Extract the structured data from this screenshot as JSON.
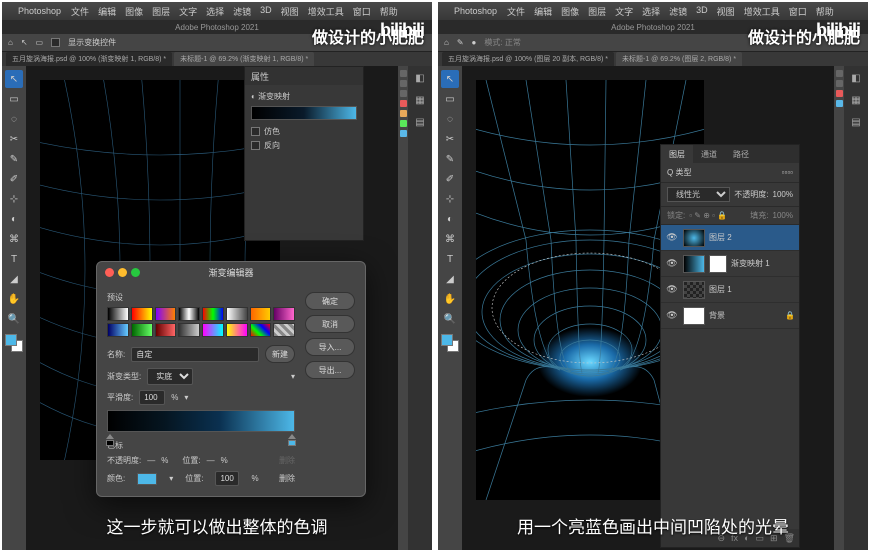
{
  "app": {
    "name": "Photoshop",
    "title": "Adobe Photoshop 2021"
  },
  "menu": [
    "文件",
    "编辑",
    "图像",
    "图层",
    "文字",
    "选择",
    "滤镜",
    "3D",
    "视图",
    "增效工具",
    "窗口",
    "帮助"
  ],
  "watermark": "做设计的小肥肥",
  "bili": "bilibili",
  "optbar_left": {
    "home": "⌂",
    "opt": "显示变换控件"
  },
  "tabs_left": [
    {
      "label": "五月旋涡海报.psd @ 100% (渐变映射 1, RGB/8) *"
    },
    {
      "label": "未标题-1 @ 69.2% (渐变映射 1, RGB/8) *"
    }
  ],
  "tabs_right": [
    {
      "label": "五月旋涡海报.psd @ 100% (图层 20 副本, RGB/8) *"
    },
    {
      "label": "未标题-1 @ 69.2% (图层 2, RGB/8) *"
    }
  ],
  "props": {
    "title": "属性",
    "type": "渐变映射",
    "dither": "仿色",
    "reverse": "反向"
  },
  "dialog": {
    "title": "渐变编辑器",
    "presets_label": "预设",
    "ok": "确定",
    "cancel": "取消",
    "import": "导入...",
    "export": "导出...",
    "name_label": "名称:",
    "name_value": "自定",
    "new_btn": "新建",
    "type_label": "渐变类型:",
    "type_value": "实底",
    "smooth_label": "平滑度:",
    "smooth_value": "100",
    "pct": "%",
    "stops_label": "色标",
    "opacity_label": "不透明度:",
    "opacity_dash": "—",
    "loc_label": "位置:",
    "loc_dash": "—",
    "color_label": "颜色:",
    "loc2_value": "100",
    "delete": "删除"
  },
  "layers": {
    "tabs": [
      "图层",
      "通道",
      "路径"
    ],
    "kind": "Q 类型",
    "blend": "线性光",
    "opacity_label": "不透明度:",
    "opacity": "100%",
    "lock": "锁定:",
    "fill_label": "填充:",
    "fill": "100%",
    "rows": [
      {
        "name": "图层 2",
        "sel": true,
        "thumb": "glow"
      },
      {
        "name": "渐变映射 1",
        "sel": false,
        "thumb": "adj"
      },
      {
        "name": "图层 1",
        "sel": false,
        "thumb": "grid"
      },
      {
        "name": "背景",
        "sel": false,
        "thumb": "white",
        "locked": true
      }
    ]
  },
  "captions": {
    "left": "这一步就可以做出整体的色调",
    "right": "用一个亮蓝色画出中间凹陷处的光晕"
  },
  "tools": [
    "↖",
    "▭",
    "◌",
    "✂",
    "✎",
    "✐",
    "⊹",
    "◐",
    "⌘",
    "T",
    "◢",
    "✋",
    "🔍"
  ],
  "presets": [
    "linear-gradient(90deg,#000,#fff)",
    "linear-gradient(90deg,#ff0000,#ffff00)",
    "linear-gradient(90deg,#8000ff,#ff8000)",
    "linear-gradient(90deg,#000,#fff,#000)",
    "linear-gradient(90deg,#ff0000,#00ff00,#0000ff)",
    "linear-gradient(90deg,#fff,transparent)",
    "linear-gradient(90deg,#ff6600,#ffcc00)",
    "linear-gradient(90deg,#660066,#ff66cc)",
    "linear-gradient(90deg,#000066,#66ccff)",
    "linear-gradient(90deg,#006600,#66ff66)",
    "linear-gradient(90deg,#660000,#ff6666)",
    "linear-gradient(90deg,#333,#ccc)",
    "linear-gradient(90deg,#ff00ff,#00ffff)",
    "linear-gradient(90deg,#ffff00,#ff00ff)",
    "linear-gradient(45deg,#ff0000,#00ff00,#0000ff,#ff0000)",
    "repeating-linear-gradient(45deg,#888 0 3px,#ccc 3px 6px)"
  ]
}
